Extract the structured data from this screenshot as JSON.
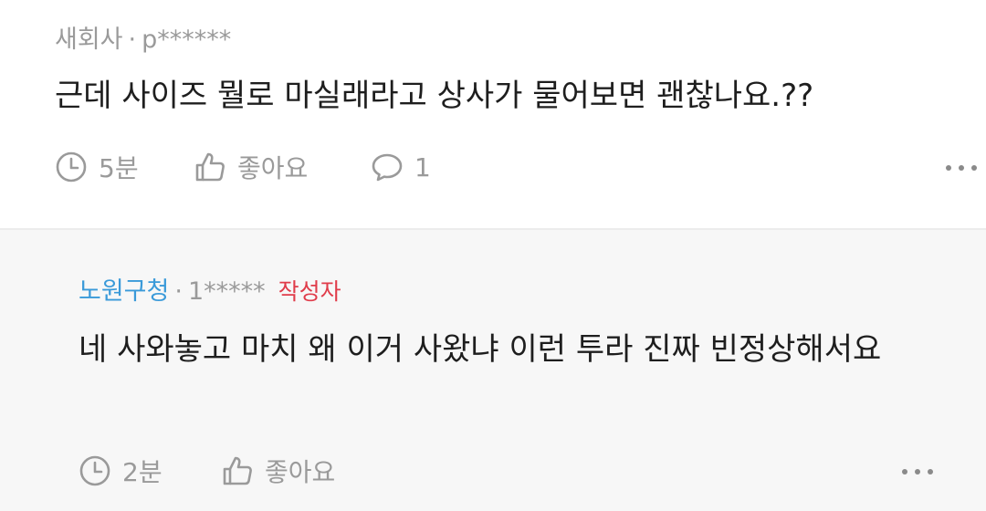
{
  "comments": [
    {
      "company": "새회사",
      "separator": "·",
      "user": "p******",
      "text": "근데 사이즈 뭘로 마실래라고 상사가 물어보면 괜찮나요.??",
      "time": "5분",
      "like_label": "좋아요",
      "reply_count": "1"
    },
    {
      "company": "노원구청",
      "separator": "·",
      "user": "1*****",
      "badge": "작성자",
      "text": "네 사와놓고 마치 왜 이거 사왔냐 이런 투라 진짜 빈정상해서요",
      "time": "2분",
      "like_label": "좋아요"
    }
  ],
  "colors": {
    "meta_gray": "#9a9a9a",
    "author_badge": "#e03c4a",
    "company_blue": "#3a9ad9",
    "reply_bg": "#f7f7f7"
  },
  "icons": [
    "clock-icon",
    "thumbs-up-icon",
    "comment-bubble-icon",
    "more-options-icon"
  ]
}
